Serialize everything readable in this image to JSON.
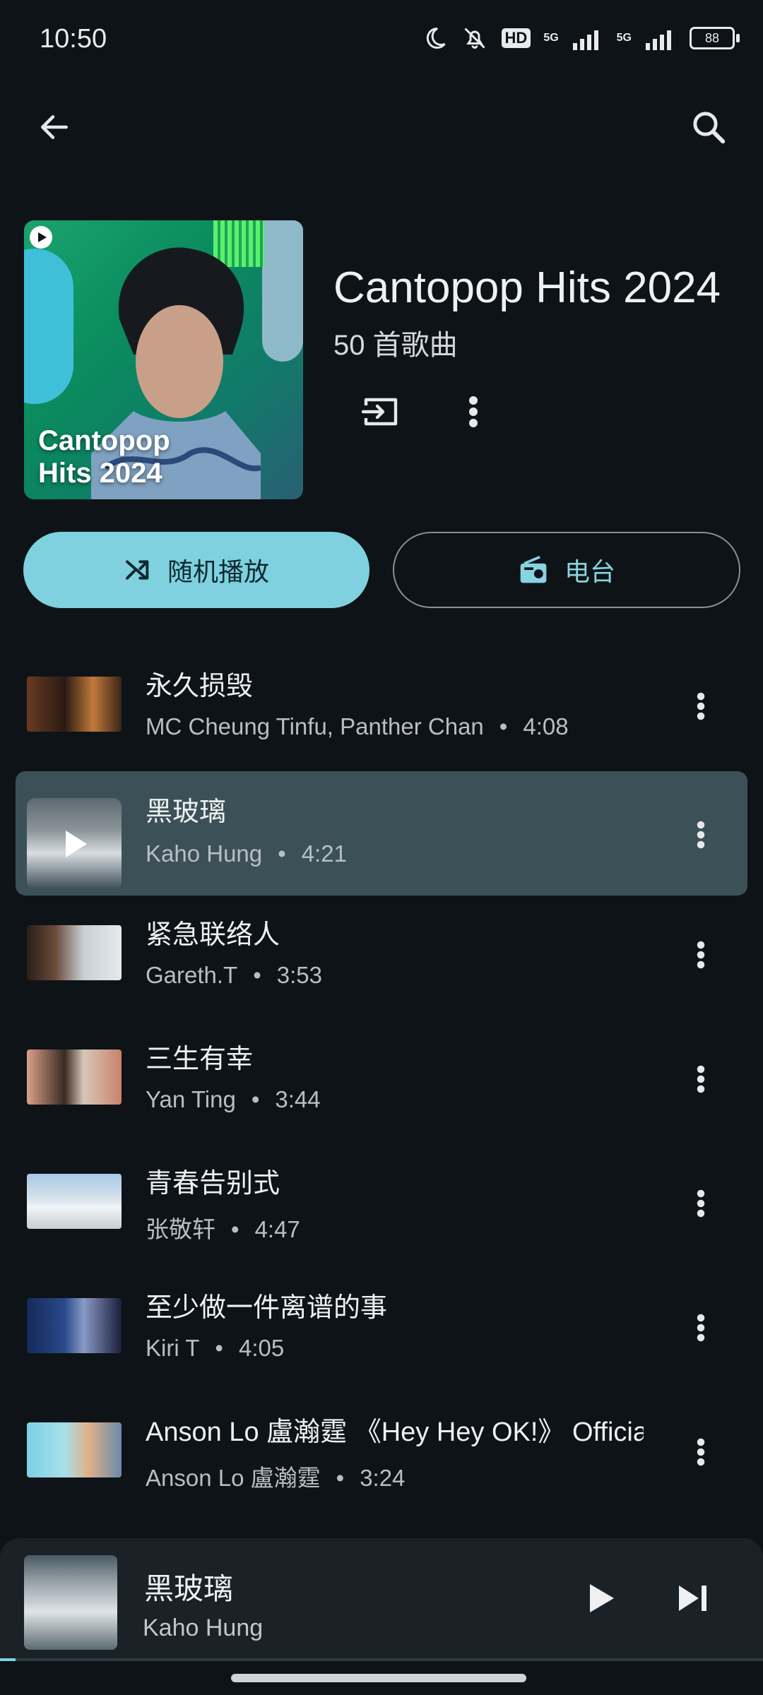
{
  "status_bar": {
    "time": "10:50",
    "net1": "5G",
    "net2": "5G",
    "hd": "HD",
    "battery": "88"
  },
  "playlist": {
    "title": "Cantopop Hits 2024",
    "cover_text": "Cantopop\nHits 2024",
    "song_count": "50 首歌曲"
  },
  "buttons": {
    "shuffle": "随机播放",
    "radio": "电台"
  },
  "songs": [
    {
      "title": "永久损毁",
      "artist": "MC Cheung Tinfu, Panther Chan",
      "duration": "4:08"
    },
    {
      "title": "黑玻璃",
      "artist": "Kaho Hung",
      "duration": "4:21"
    },
    {
      "title": "紧急联络人",
      "artist": "Gareth.T",
      "duration": "3:53"
    },
    {
      "title": "三生有幸",
      "artist": "Yan Ting",
      "duration": "3:44"
    },
    {
      "title": "青春告别式",
      "artist": "张敬轩",
      "duration": "4:47"
    },
    {
      "title": "至少做一件离谱的事",
      "artist": "Kiri T",
      "duration": "4:05"
    },
    {
      "title": "Anson Lo 盧瀚霆 《Hey Hey OK!》 Official",
      "artist": "Anson Lo 盧瀚霆",
      "duration": "3:24"
    }
  ],
  "now_playing": {
    "title": "黑玻璃",
    "artist": "Kaho Hung",
    "progress": 0.02
  },
  "colors": {
    "background": "#0e1317",
    "accent": "#7fd1df",
    "highlight_row": "#3b5157"
  }
}
